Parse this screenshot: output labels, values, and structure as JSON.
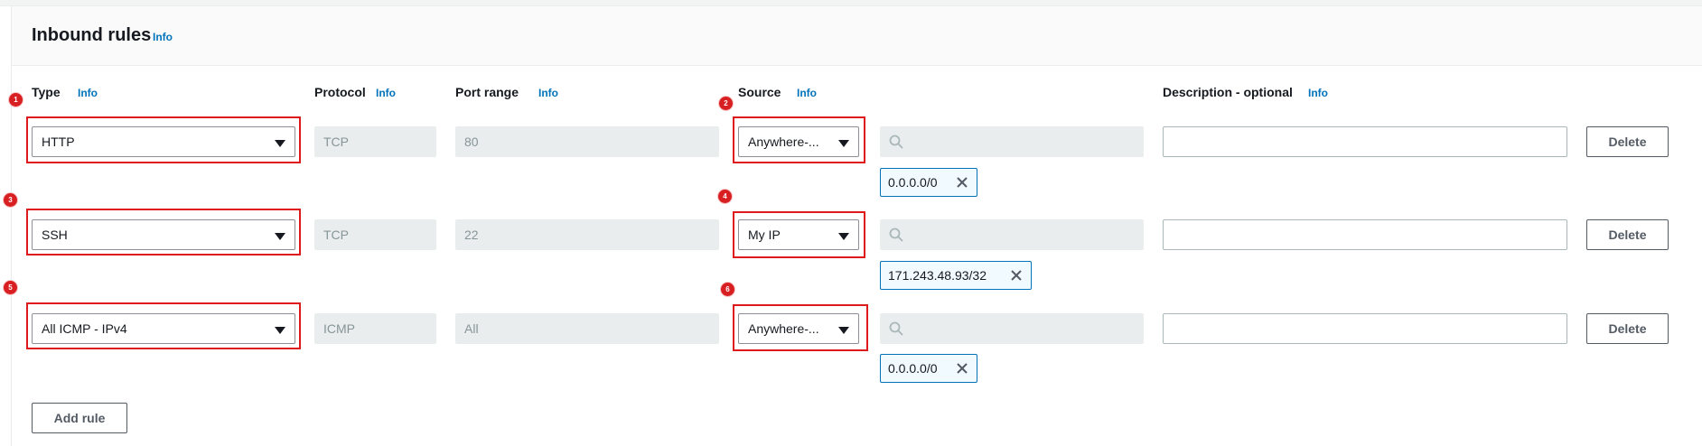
{
  "section": {
    "title": "Inbound rules",
    "info": "Info"
  },
  "columns": {
    "type": "Type",
    "protocol": "Protocol",
    "port_range": "Port range",
    "source": "Source",
    "description": "Description - optional",
    "info": "Info"
  },
  "rules": [
    {
      "type": "HTTP",
      "protocol": "TCP",
      "port_range": "80",
      "source": "Anywhere-...",
      "token": "0.0.0.0/0",
      "delete": "Delete",
      "type_badge": "1",
      "source_badge": "2"
    },
    {
      "type": "SSH",
      "protocol": "TCP",
      "port_range": "22",
      "source": "My IP",
      "token": "171.243.48.93/32",
      "delete": "Delete",
      "type_badge": "3",
      "source_badge": "4"
    },
    {
      "type": "All ICMP - IPv4",
      "protocol": "ICMP",
      "port_range": "All",
      "source": "Anywhere-...",
      "token": "0.0.0.0/0",
      "delete": "Delete",
      "type_badge": "5",
      "source_badge": "6"
    }
  ],
  "add_rule": "Add rule",
  "icons": {
    "search": "search-icon",
    "close": "close-icon",
    "caret": "caret-down-icon"
  },
  "colors": {
    "link": "#0073bb",
    "highlight": "#e0191d",
    "token_border": "#0073bb"
  }
}
